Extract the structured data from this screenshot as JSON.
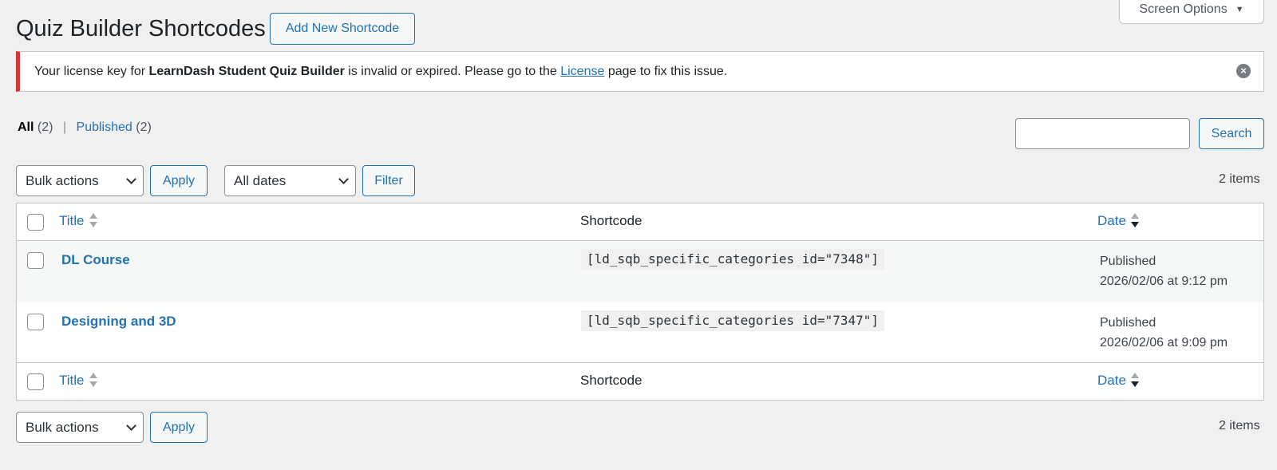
{
  "header": {
    "title": "Quiz Builder Shortcodes",
    "add_new_label": "Add New Shortcode",
    "screen_options_label": "Screen Options"
  },
  "notice": {
    "prefix": "Your license key for ",
    "product": "LearnDash Student Quiz Builder",
    "middle": " is invalid or expired. Please go to the ",
    "link_text": "License",
    "suffix": " page to fix this issue."
  },
  "views": {
    "all_label": "All",
    "all_count": "(2)",
    "separator": "|",
    "published_label": "Published",
    "published_count": "(2)"
  },
  "search": {
    "placeholder": "",
    "button_label": "Search"
  },
  "tablenav_top": {
    "bulk_actions": "Bulk actions",
    "apply_label": "Apply",
    "dates": "All dates",
    "filter_label": "Filter",
    "items_count": "2 items"
  },
  "tablenav_bottom": {
    "bulk_actions": "Bulk actions",
    "apply_label": "Apply",
    "items_count": "2 items"
  },
  "columns": {
    "title": "Title",
    "shortcode": "Shortcode",
    "date": "Date"
  },
  "rows": [
    {
      "title": "DL Course",
      "shortcode": "[ld_sqb_specific_categories id=\"7348\"]",
      "status": "Published",
      "date": "2026/02/06 at 9:12 pm"
    },
    {
      "title": "Designing and 3D",
      "shortcode": "[ld_sqb_specific_categories id=\"7347\"]",
      "status": "Published",
      "date": "2026/02/06 at 9:09 pm"
    }
  ],
  "colors": {
    "link": "#2271b1",
    "notice_error": "#d63638",
    "background": "#f0f0f1"
  }
}
